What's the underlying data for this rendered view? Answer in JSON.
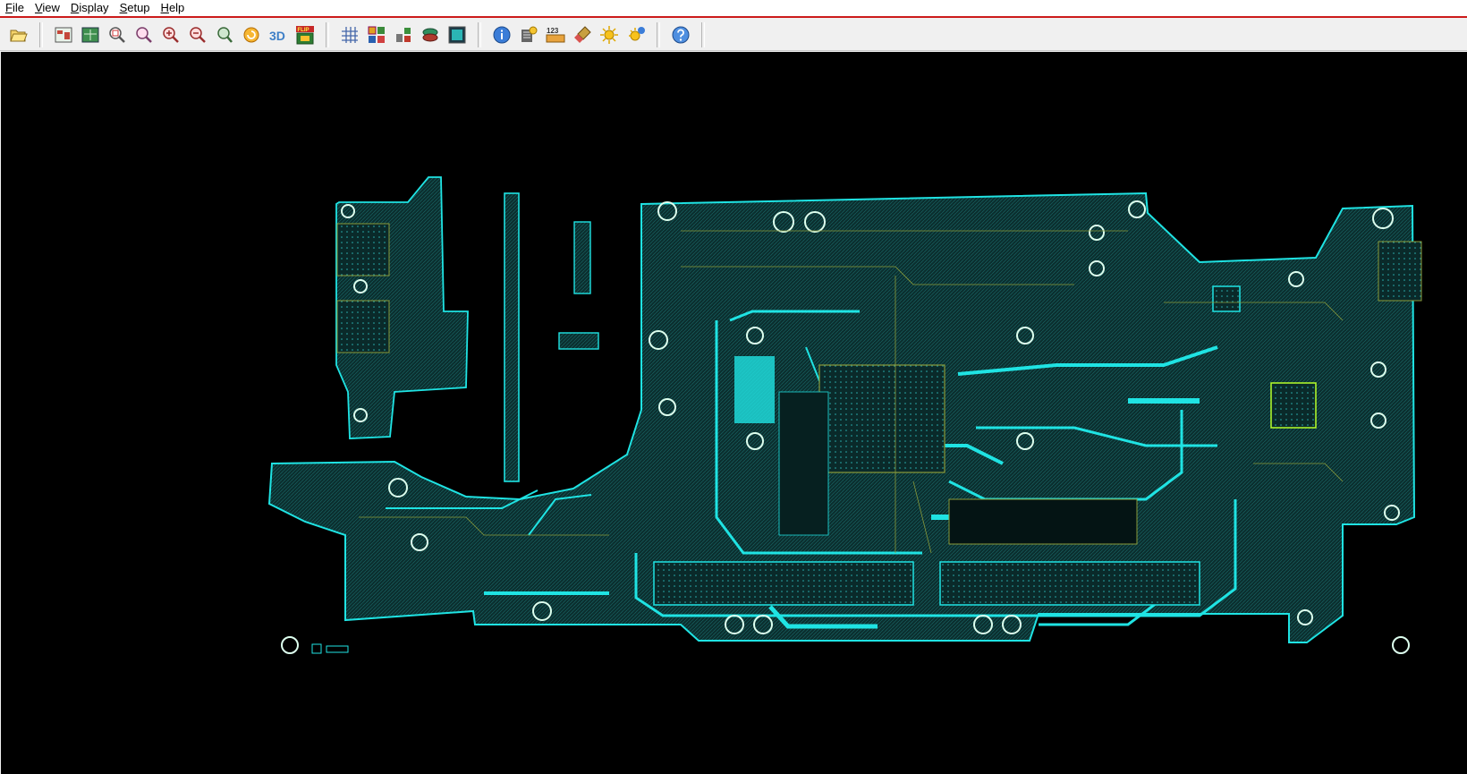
{
  "menu": {
    "file": {
      "label": "File"
    },
    "view": {
      "label": "View"
    },
    "display": {
      "label": "Display"
    },
    "setup": {
      "label": "Setup"
    },
    "help": {
      "label": "Help"
    }
  },
  "toolbar": {
    "groups": [
      [
        "folder-open-icon"
      ],
      [
        "board-view-icon",
        "board-grid-icon",
        "zoom-area-icon",
        "zoom-fit-icon",
        "zoom-in-icon",
        "zoom-out-icon",
        "pan-hand-icon",
        "rotate-icon",
        "3d-view-icon",
        "flip-board-icon"
      ],
      [
        "grid-icon",
        "layers-icon",
        "components-icon",
        "nets-icon",
        "render-icon"
      ],
      [
        "info-icon",
        "net-list-icon",
        "pin-numbers-icon",
        "clean-icon",
        "brightness-icon",
        "highlight-icon"
      ],
      [
        "help-icon"
      ]
    ],
    "flip_label": "FLIP",
    "pin_label": "123",
    "threed_label": "3D"
  },
  "colors": {
    "menubar_accent": "#cc1b1b",
    "canvas_bg": "#000000",
    "trace_cyan": "#1fe3e3",
    "trace_olive": "#8a9a3a",
    "board_fill": "#0d3a3a"
  }
}
